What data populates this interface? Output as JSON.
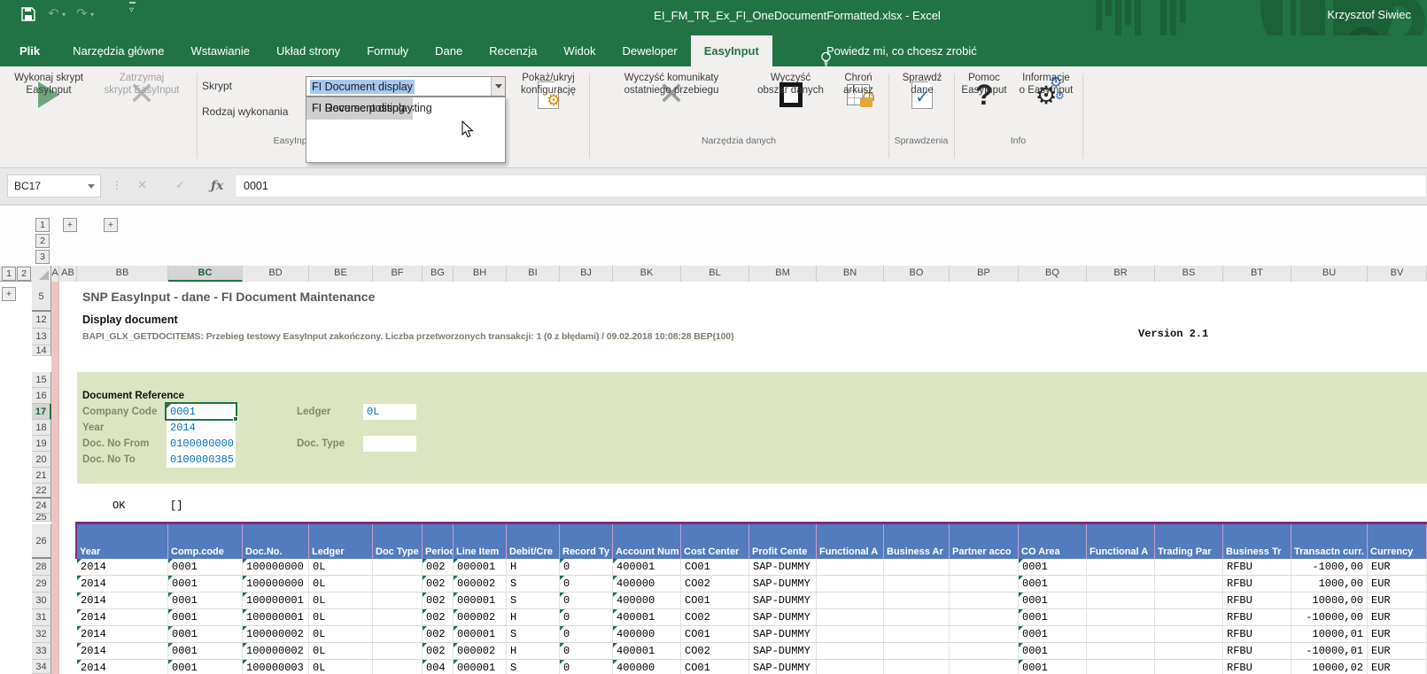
{
  "titlebar": {
    "title": "EI_FM_TR_Ex_FI_OneDocumentFormatted.xlsx  -  Excel",
    "user": "Krzysztof Siwiec"
  },
  "tabs": [
    {
      "label": "Plik",
      "active": false
    },
    {
      "label": "Narzędzia główne",
      "active": false
    },
    {
      "label": "Wstawianie",
      "active": false
    },
    {
      "label": "Układ strony",
      "active": false
    },
    {
      "label": "Formuły",
      "active": false
    },
    {
      "label": "Dane",
      "active": false
    },
    {
      "label": "Recenzja",
      "active": false
    },
    {
      "label": "Widok",
      "active": false
    },
    {
      "label": "Deweloper",
      "active": false
    },
    {
      "label": "EasyInput",
      "active": true
    }
  ],
  "tell_me": "Powiedz mi, co chcesz zrobić",
  "ribbon": {
    "run_label": "Wykonaj skrypt\nEasyInput",
    "stop_label": "Zatrzymaj\nskrypt EasyInput",
    "script_label": "Skrypt",
    "exec_mode_label": "Rodzaj wykonania",
    "script_combo_value": "FI Document display",
    "dropdown_items": [
      {
        "label": "FI-GL Document posting",
        "highlighted": false
      },
      {
        "label": "FI Document display",
        "highlighted": true
      },
      {
        "label": "FI Reverse posting",
        "highlighted": false
      }
    ],
    "buttons": [
      {
        "label": "Pokaż/ukryj\nkonfigurację",
        "icon": "show-hide-config-icon"
      },
      {
        "label": "Wyczyść komunikaty\nostatniego przebiegu",
        "icon": "clear-messages-icon"
      },
      {
        "label": "Wyczyść\nobszar danych",
        "icon": "clear-data-area-icon"
      },
      {
        "label": "Chroń\narkusz",
        "icon": "protect-sheet-icon"
      },
      {
        "label": "Sprawdź\ndane",
        "icon": "check-data-icon"
      },
      {
        "label": "Pomoc\nEasyInput",
        "icon": "help-icon"
      },
      {
        "label": "Informacje\no EasyInput",
        "icon": "about-icon"
      }
    ],
    "groups": [
      "EasyInput",
      "Narzędzia danych",
      "Sprawdzenia",
      "Info"
    ]
  },
  "formula_bar": {
    "name_box": "BC17",
    "fx": "ƒx",
    "value": "0001"
  },
  "outline": {
    "column_levels": [
      "1",
      "2",
      "3"
    ],
    "row_levels": [
      "1",
      "2"
    ],
    "expand": "+"
  },
  "sheet": {
    "column_letters": [
      "A",
      "AB",
      "BB",
      "BC",
      "BD",
      "BE",
      "BF",
      "BG",
      "BH",
      "BI",
      "BJ",
      "BK",
      "BL",
      "BM",
      "BN",
      "BO",
      "BP",
      "BQ",
      "BR",
      "BS",
      "BT",
      "BU",
      "BV"
    ],
    "selected_column": "BC",
    "selected_row": "17",
    "row_numbers": [
      "5",
      "12",
      "13",
      "14",
      "15",
      "16",
      "17",
      "18",
      "19",
      "20",
      "21",
      "22",
      "24",
      "25",
      "26",
      "28",
      "29",
      "30",
      "31",
      "32",
      "33",
      "34"
    ],
    "title": "SNP EasyInput - dane - FI Document Maintenance",
    "subtitle": "Display document",
    "version": "Version 2.1",
    "bapi_message": "BAPI_GLX_GETDOCITEMS: Przebieg testowy EasyInput zakończony. Liczba przetworzonych transakcji: 1 (0 z błędami) / 09.02.2018 10:08:28 BEP(100)",
    "form": {
      "section_title": "Document Reference",
      "fields_left": [
        {
          "label": "Company Code",
          "value": "0001"
        },
        {
          "label": "Year",
          "value": "2014"
        },
        {
          "label": "Doc. No From",
          "value": "0100000000"
        },
        {
          "label": "Doc. No To",
          "value": "0100000385"
        }
      ],
      "fields_right": [
        {
          "label": "Ledger",
          "value": "0L"
        },
        {
          "label": "Doc. Type",
          "value": ""
        }
      ]
    },
    "ok_label": "OK",
    "ok_value": "[]",
    "table": {
      "headers": [
        "Year",
        "Comp.code",
        "Doc.No.",
        "Ledger",
        "Doc Type",
        "Period",
        "Line Item",
        "Debit/Cre",
        "Record Ty",
        "Account Num",
        "Cost Center",
        "Profit Cente",
        "Functional A",
        "Business Ar",
        "Partner acco",
        "CO Area",
        "Functional A",
        "Trading Par",
        "Business Tr",
        "Transactn curr.",
        "Currency"
      ],
      "rows": [
        [
          "2014",
          "0001",
          "100000000",
          "0L",
          "",
          "002",
          "000001",
          "H",
          "0",
          "400001",
          "CO01",
          "SAP-DUMMY",
          "",
          "",
          "",
          "0001",
          "",
          "",
          "RFBU",
          "-1000,00",
          "EUR"
        ],
        [
          "2014",
          "0001",
          "100000000",
          "0L",
          "",
          "002",
          "000002",
          "S",
          "0",
          "400000",
          "CO02",
          "SAP-DUMMY",
          "",
          "",
          "",
          "0001",
          "",
          "",
          "RFBU",
          "1000,00",
          "EUR"
        ],
        [
          "2014",
          "0001",
          "100000001",
          "0L",
          "",
          "002",
          "000001",
          "S",
          "0",
          "400000",
          "CO01",
          "SAP-DUMMY",
          "",
          "",
          "",
          "0001",
          "",
          "",
          "RFBU",
          "10000,00",
          "EUR"
        ],
        [
          "2014",
          "0001",
          "100000001",
          "0L",
          "",
          "002",
          "000002",
          "H",
          "0",
          "400001",
          "CO02",
          "SAP-DUMMY",
          "",
          "",
          "",
          "0001",
          "",
          "",
          "RFBU",
          "-10000,00",
          "EUR"
        ],
        [
          "2014",
          "0001",
          "100000002",
          "0L",
          "",
          "002",
          "000001",
          "S",
          "0",
          "400000",
          "CO01",
          "SAP-DUMMY",
          "",
          "",
          "",
          "0001",
          "",
          "",
          "RFBU",
          "10000,01",
          "EUR"
        ],
        [
          "2014",
          "0001",
          "100000002",
          "0L",
          "",
          "002",
          "000002",
          "H",
          "0",
          "400001",
          "CO02",
          "SAP-DUMMY",
          "",
          "",
          "",
          "0001",
          "",
          "",
          "RFBU",
          "-10000,01",
          "EUR"
        ],
        [
          "2014",
          "0001",
          "100000003",
          "0L",
          "",
          "004",
          "000001",
          "S",
          "0",
          "400000",
          "CO01",
          "SAP-DUMMY",
          "",
          "",
          "",
          "0001",
          "",
          "",
          "RFBU",
          "10000,02",
          "EUR"
        ]
      ]
    }
  },
  "colors": {
    "excel_green": "#217346",
    "table_header_blue": "#537cbe",
    "table_border_purple": "#7d2b87",
    "form_band_green": "#dbe5c1",
    "value_text_blue": "#0070c0",
    "marker_column_pink": "#edc6c4"
  }
}
